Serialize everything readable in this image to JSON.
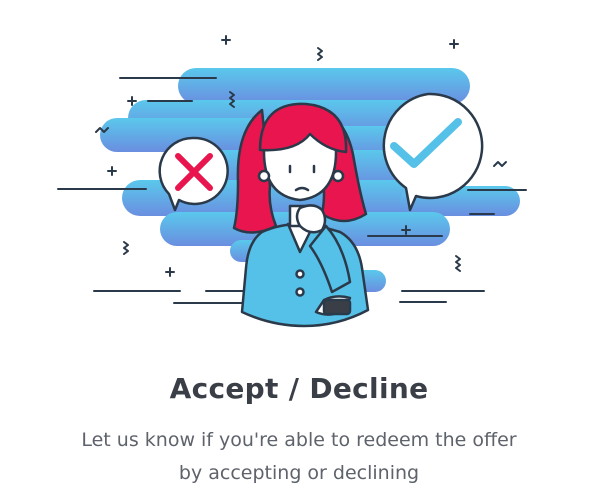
{
  "onboarding": {
    "title": "Accept / Decline",
    "subtitle_line1": "Let us know if you're able to redeem the offer",
    "subtitle_line2": "by accepting or declining"
  },
  "icons": {
    "decline": "x-mark-icon",
    "accept": "check-mark-icon"
  },
  "colors": {
    "hair": "#e8154f",
    "sky_gradient_top": "#5ac8ec",
    "sky_gradient_bottom": "#6a8ee0",
    "shirt": "#55c1e8",
    "check": "#55c1e8",
    "cross": "#e8154f",
    "outline": "#2b3a4a",
    "title_text": "#3a3f47",
    "body_text": "#5e636b"
  }
}
